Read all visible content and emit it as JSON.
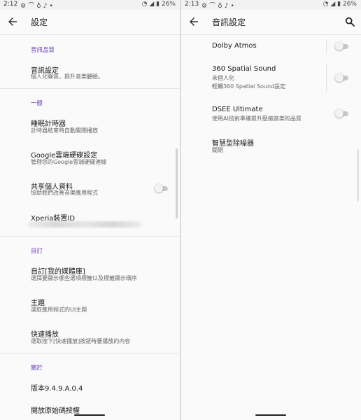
{
  "left": {
    "status": {
      "time": "2:12",
      "battery": "26%",
      "icons": [
        "gear-icon",
        "cast-icon",
        "bulb-icon",
        "music-note-icon",
        "dot-icon",
        "wifi-icon",
        "signal-icon",
        "battery-icon"
      ]
    },
    "appbar": {
      "title": "設定"
    },
    "sections": {
      "audio": {
        "header": "音訊品質",
        "items": [
          {
            "title": "音訊設定",
            "subtitle": "個人化聲音，提升音樂體驗。"
          }
        ]
      },
      "general": {
        "header": "一般",
        "items": [
          {
            "title": "睡眠計時器",
            "subtitle": "計時器結束時自動關閉播放"
          },
          {
            "title": "Google雲端硬碟設定",
            "subtitle": "管理您的Google雲端硬碟連線"
          },
          {
            "title": "共享個人資料",
            "subtitle": "協助我們改善音樂應用程式",
            "toggle_on": false
          },
          {
            "title": "Xperia裝置ID",
            "subtitle": ""
          }
        ]
      },
      "custom": {
        "header": "自訂",
        "items": [
          {
            "title": "自訂[我的媒體庫]",
            "subtitle": "選擇要顯示哪些選項標籤以及標籤顯示順序"
          },
          {
            "title": "主題",
            "subtitle": "選取應用程式的UI主題"
          },
          {
            "title": "快速播放",
            "subtitle": "選取按下[快速播放]按鈕時要播放的內容"
          }
        ]
      },
      "about": {
        "header": "關於",
        "items": [
          {
            "title": "版本9.4.9.A.0.4"
          },
          {
            "title": "開放原始碼授權"
          }
        ]
      }
    }
  },
  "right": {
    "status": {
      "time": "2:13",
      "battery": "26%",
      "icons": [
        "gear-icon",
        "cast-icon",
        "bulb-icon",
        "music-note-icon",
        "dot-icon",
        "wifi-icon",
        "signal-icon",
        "battery-icon"
      ]
    },
    "appbar": {
      "title": "音訊設定"
    },
    "items": [
      {
        "title": "Dolby Atmos",
        "toggle_on": false
      },
      {
        "title": "360 Spatial Sound",
        "subtitle": "未個人化",
        "subtitle2": "輕觸360 Spatial Sound設定",
        "toggle_on": false
      },
      {
        "title": "DSEE Ultimate",
        "subtitle": "使用AI技術準確提升壓縮音樂的品質",
        "toggle_on": false
      },
      {
        "title": "智慧型除噪器",
        "subtitle": "關閉"
      }
    ]
  }
}
